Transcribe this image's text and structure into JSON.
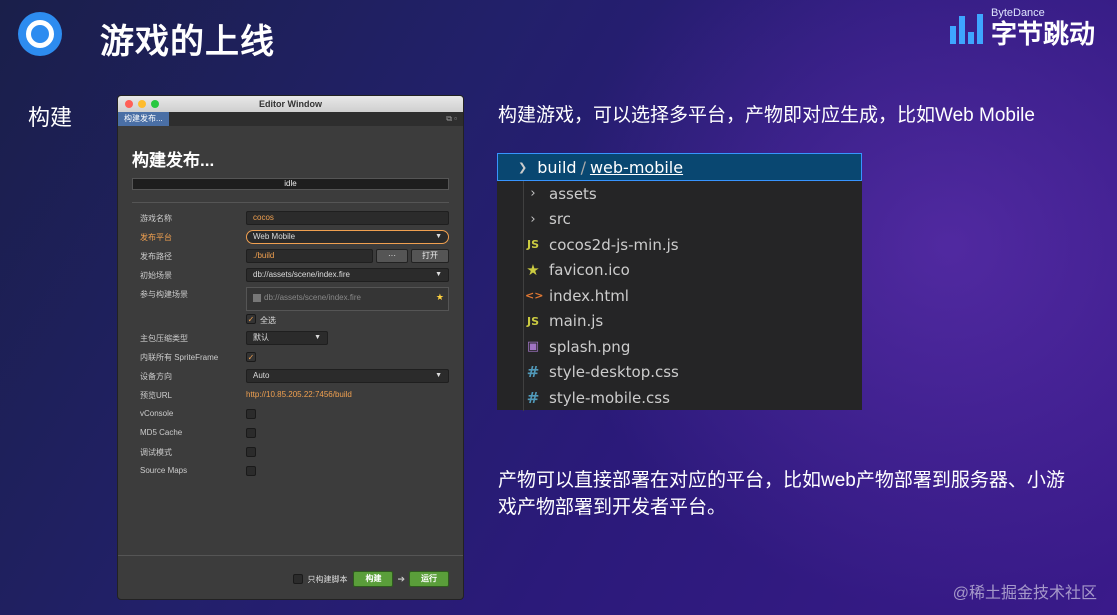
{
  "slide": {
    "title": "游戏的上线",
    "brand_small": "ByteDance",
    "brand_big": "字节跳动",
    "left_label": "构建",
    "desc_build": "构建游戏，可以选择多平台，产物即对应生成，比如Web Mobile",
    "desc_deploy": "产物可以直接部署在对应的平台，比如web产物部署到服务器、小游戏产物部署到开发者平台。",
    "watermark": "@稀土掘金技术社区"
  },
  "editor": {
    "window_title": "Editor Window",
    "tab_label": "构建发布...",
    "heading": "构建发布...",
    "status": "idle",
    "fields": {
      "game_name_label": "游戏名称",
      "game_name_value": "cocos",
      "platform_label": "发布平台",
      "platform_value": "Web Mobile",
      "path_label": "发布路径",
      "path_value": "./build",
      "path_browse": "···",
      "path_open": "打开",
      "start_scene_label": "初始场景",
      "start_scene_value": "db://assets/scene/index.fire",
      "included_scenes_label": "参与构建场景",
      "included_scene_item": "db://assets/scene/index.fire",
      "select_all": "全选",
      "compression_label": "主包压缩类型",
      "compression_value": "默认",
      "inline_spriteframe_label": "内联所有 SpriteFrame",
      "orientation_label": "设备方向",
      "orientation_value": "Auto",
      "preview_url_label": "预览URL",
      "preview_url_value": "http://10.85.205.22:7456/build",
      "vconsole_label": "vConsole",
      "md5_label": "MD5 Cache",
      "debug_label": "调试模式",
      "sourcemaps_label": "Source Maps"
    },
    "footer": {
      "build_script_only": "只构建脚本",
      "build_button": "构建",
      "run_button": "运行"
    }
  },
  "file_tree": {
    "root": "build",
    "separator": "/",
    "leaf": "web-mobile",
    "items": [
      {
        "name": "assets",
        "icon": "folder-chevron-icon"
      },
      {
        "name": "src",
        "icon": "folder-chevron-icon"
      },
      {
        "name": "cocos2d-js-min.js",
        "icon": "js-file-icon",
        "glyph": "JS"
      },
      {
        "name": "favicon.ico",
        "icon": "star-file-icon",
        "glyph": "★"
      },
      {
        "name": "index.html",
        "icon": "html-file-icon",
        "glyph": "<>"
      },
      {
        "name": "main.js",
        "icon": "js-file-icon",
        "glyph": "JS"
      },
      {
        "name": "splash.png",
        "icon": "image-file-icon",
        "glyph": "▣"
      },
      {
        "name": "style-desktop.css",
        "icon": "css-file-icon",
        "glyph": "#"
      },
      {
        "name": "style-mobile.css",
        "icon": "css-file-icon",
        "glyph": "#"
      }
    ]
  },
  "colors": {
    "accent_orange": "#f0a050",
    "run_green": "#5a9e3a",
    "tree_selected": "#094771"
  }
}
